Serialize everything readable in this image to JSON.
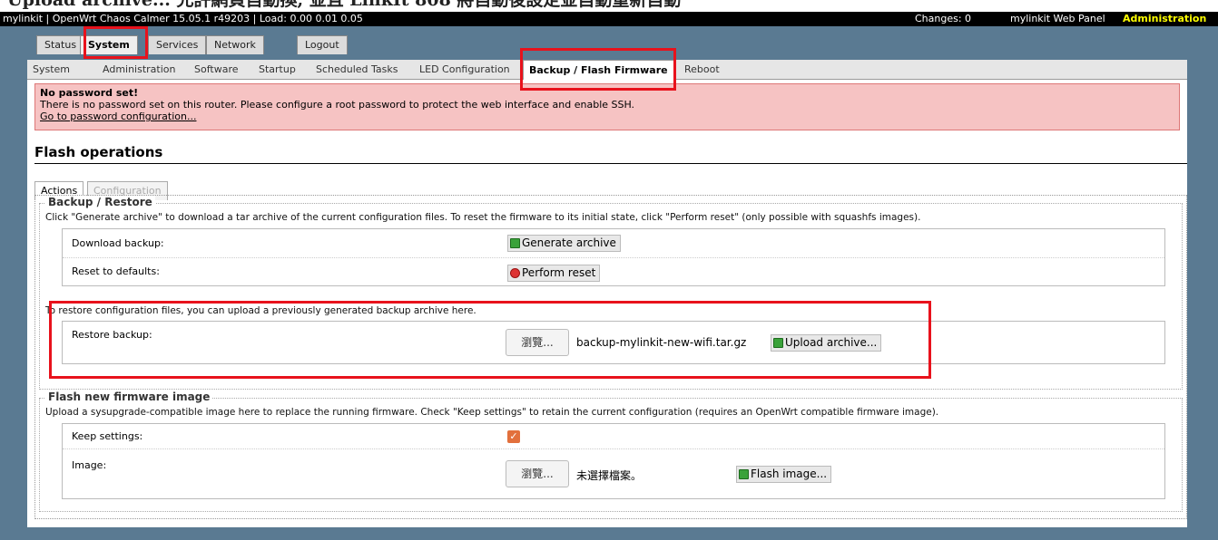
{
  "caption": "Upload archive... 允許網頁自動換, 並且 LinkIt 808 將自動後設定並自動重新自動",
  "topbar": {
    "system_info": "mylinkit | OpenWrt Chaos Calmer 15.05.1 r49203 | Load: 0.00 0.01 0.05",
    "changes": "Changes: 0",
    "panel": "mylinkit Web Panel",
    "admin": "Administration"
  },
  "main_tabs": [
    "Status",
    "System",
    "Services",
    "Network",
    "Logout"
  ],
  "sub_tabs": [
    "System",
    "Administration",
    "Software",
    "Startup",
    "Scheduled Tasks",
    "LED Configuration",
    "Backup / Flash Firmware",
    "Reboot"
  ],
  "alert": {
    "title": "No password set!",
    "message": "There is no password set on this router. Please configure a root password to protect the web interface and enable SSH.",
    "link": "Go to password configuration..."
  },
  "page_title": "Flash operations",
  "section_tabs": [
    "Actions",
    "Configuration"
  ],
  "backup": {
    "legend": "Backup / Restore",
    "description": "Click \"Generate archive\" to download a tar archive of the current configuration files. To reset the firmware to its initial state, click \"Perform reset\" (only possible with squashfs images).",
    "download_label": "Download backup:",
    "generate_button": "Generate archive",
    "reset_label": "Reset to defaults:",
    "reset_button": "Perform reset",
    "restore_description": "To restore configuration files, you can upload a previously generated backup archive here.",
    "restore_label": "Restore backup:",
    "browse_button": "瀏覽...",
    "restore_file": "backup-mylinkit-new-wifi.tar.gz",
    "upload_button": "Upload archive..."
  },
  "flash": {
    "legend": "Flash new firmware image",
    "description": "Upload a sysupgrade-compatible image here to replace the running firmware. Check \"Keep settings\" to retain the current configuration (requires an OpenWrt compatible firmware image).",
    "keep_label": "Keep settings:",
    "keep_checked": true,
    "image_label": "Image:",
    "browse_button": "瀏覽...",
    "no_file": "未選擇檔案。",
    "flash_button": "Flash image..."
  },
  "colors": {
    "highlight": "#e8121c",
    "background": "#5a7a92",
    "admin_accent": "#ffff00",
    "alert_bg": "#f6c3c3"
  }
}
